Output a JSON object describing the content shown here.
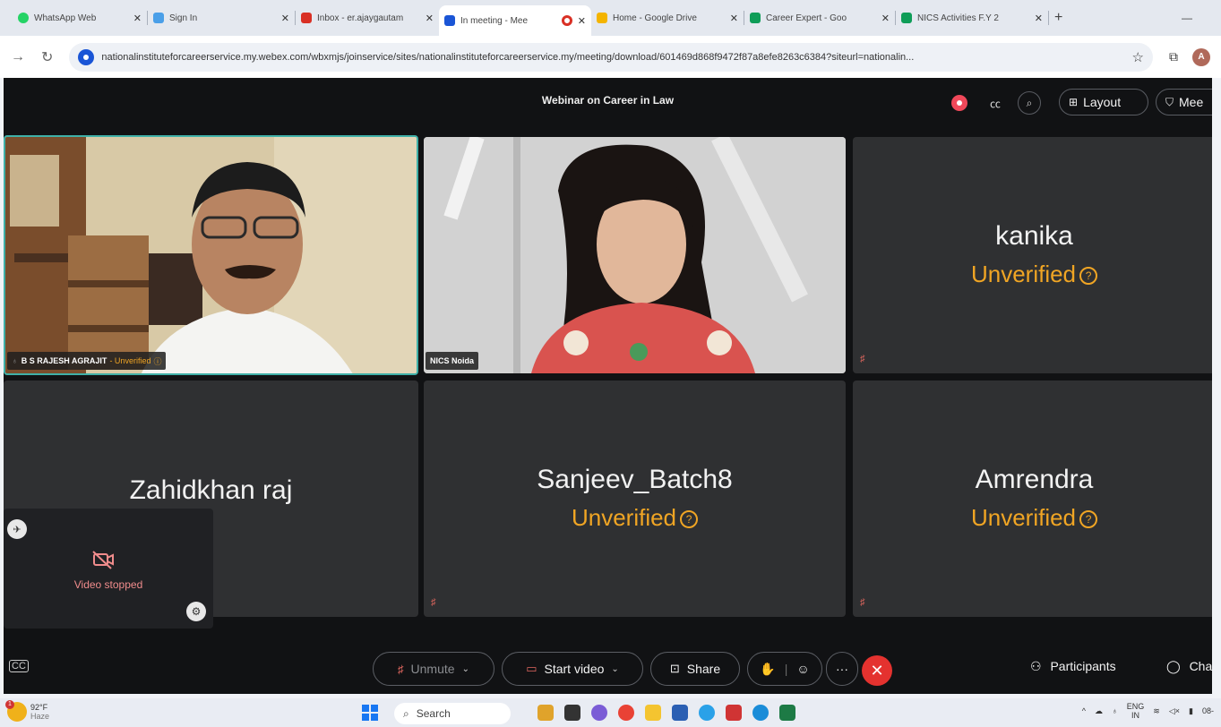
{
  "tabs": [
    {
      "title": "WhatsApp Web",
      "fav": "#25d366",
      "icon": "whatsapp-icon"
    },
    {
      "title": "Sign In",
      "fav": "#4a9fe8",
      "icon": "signin-icon"
    },
    {
      "title": "Inbox - er.ajaygautam",
      "fav": "#d93025",
      "icon": "gmail-icon"
    },
    {
      "title": "In meeting - Mee",
      "fav": "#1a55d6",
      "icon": "webex-icon",
      "active": true
    },
    {
      "title": "Home - Google Drive",
      "fav": "#f4b400",
      "icon": "google-drive-icon"
    },
    {
      "title": "Career Expert - Goo",
      "fav": "#0f9d58",
      "icon": "sheets-icon"
    },
    {
      "title": "NICS Activities F.Y 2",
      "fav": "#0f9d58",
      "icon": "sheets-icon"
    }
  ],
  "browser": {
    "url": "nationalinstituteforcareerservice.my.webex.com/wbxmjs/joinservice/sites/nationalinstituteforcareerservice.my/meeting/download/601469d868f9472f87a8efe8263c6384?siteurl=nationalin...",
    "profile_initial": "A",
    "new_tab": "+",
    "minimize": "—"
  },
  "meeting": {
    "title": "Webinar on Career in Law",
    "layout_label": "Layout",
    "meeting_label": "Mee"
  },
  "tiles": [
    {
      "type": "video",
      "label_name": "B S RAJESH AGRAJIT",
      "label_status": "- Unverified"
    },
    {
      "type": "video",
      "label_name": "NICS Noida"
    },
    {
      "type": "name",
      "name": "kanika",
      "status": "Unverified"
    },
    {
      "type": "name",
      "name": "Zahidkhan raj"
    },
    {
      "type": "name",
      "name": "Sanjeev_Batch8",
      "status": "Unverified"
    },
    {
      "type": "name",
      "name": "Amrendra",
      "status": "Unverified"
    }
  ],
  "selfview": {
    "label": "Video stopped"
  },
  "controls": {
    "unmute": "Unmute",
    "start_video": "Start video",
    "share": "Share",
    "more": "···",
    "participants": "Participants",
    "chat": "Cha"
  },
  "taskbar": {
    "temp": "92°F",
    "weather": "Haze",
    "search": "Search",
    "lang1": "ENG",
    "lang2": "IN",
    "time": "08-"
  },
  "colors": {
    "unverified": "#f0a524",
    "active_border": "#3fb0a8",
    "end_call": "#e4322f",
    "recording": "#f0485a"
  }
}
